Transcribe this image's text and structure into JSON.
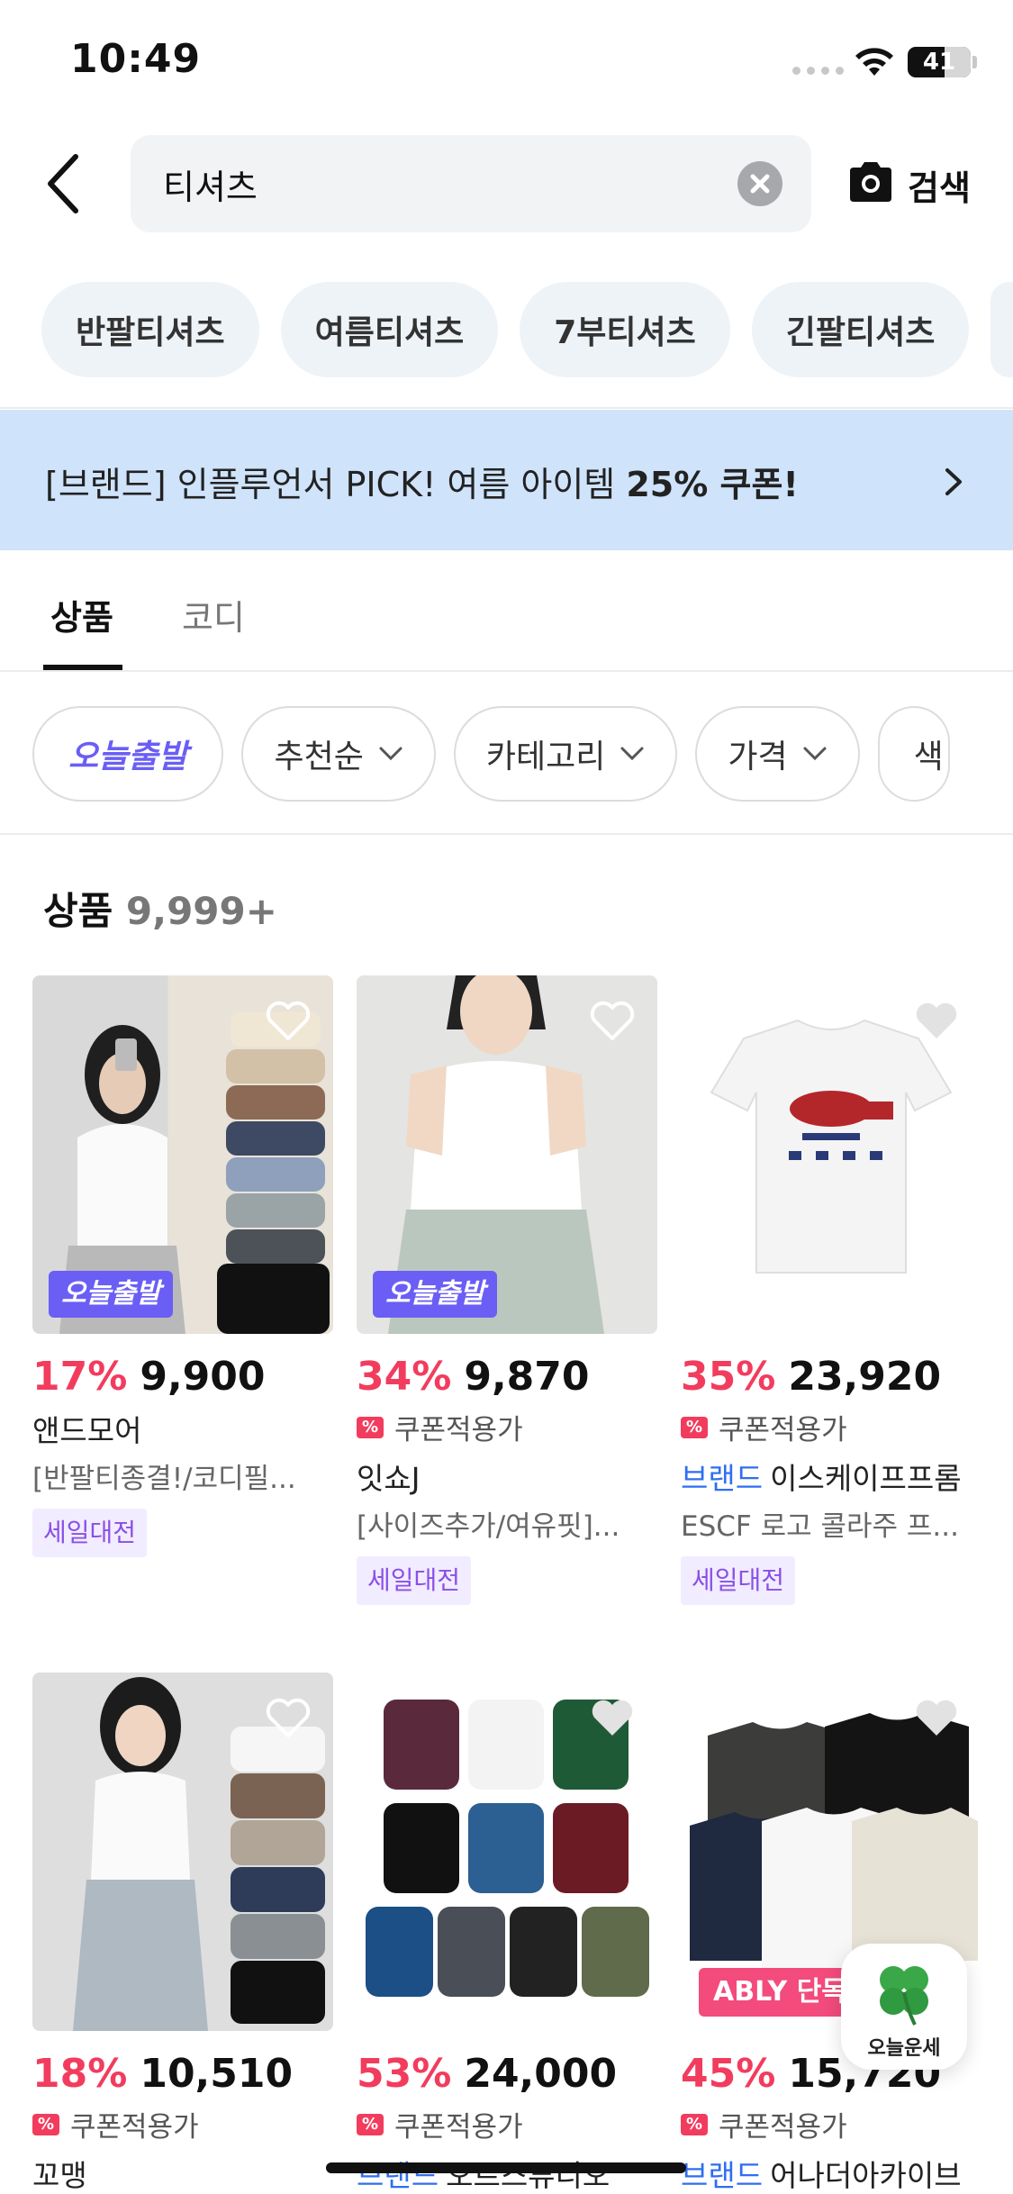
{
  "status_bar": {
    "time": "10:49",
    "battery": "41"
  },
  "search": {
    "query": "티셔츠",
    "submit_label": "검색"
  },
  "keyword_chips": [
    "반팔티셔츠",
    "여름티셔츠",
    "7부티셔츠",
    "긴팔티셔츠"
  ],
  "banner": {
    "text_prefix": "[브랜드] 인플루언서 PICK! 여름 아이템 ",
    "text_bold": "25% 쿠폰!"
  },
  "tabs": {
    "products": "상품",
    "coordi": "코디"
  },
  "filters": {
    "today": "오늘출발",
    "sort": "추천순",
    "category": "카테고리",
    "price": "가격",
    "color_partial": "색"
  },
  "product_count": {
    "label": "상품",
    "value": "9,999+"
  },
  "products": [
    {
      "discount": "17%",
      "price": "9,900",
      "store": "앤드모어",
      "desc": "[반팔티종결!/코디필...",
      "tag": "세일대전",
      "badge": "오늘출발"
    },
    {
      "discount": "34%",
      "price": "9,870",
      "coupon": "쿠폰적용가",
      "store": "잇쇼J",
      "desc": "[사이즈추가/여유핏]...",
      "tag": "세일대전",
      "badge": "오늘출발"
    },
    {
      "discount": "35%",
      "price": "23,920",
      "coupon": "쿠폰적용가",
      "brand_tag": "브랜드",
      "store": "이스케이프프롬",
      "desc": "ESCF 로고 콜라주 프...",
      "tag": "세일대전"
    },
    {
      "discount": "18%",
      "price": "10,510",
      "coupon": "쿠폰적용가",
      "store": "꼬맹"
    },
    {
      "discount": "53%",
      "price": "24,000",
      "coupon": "쿠폰적용가",
      "brand_tag": "브랜드",
      "store": "오르스튜디오"
    },
    {
      "discount": "45%",
      "price": "15,720",
      "coupon": "쿠폰적용가",
      "brand_tag": "브랜드",
      "store": "어나더아카이브",
      "badge": "ABLY 단독"
    }
  ],
  "fortune": {
    "label": "오늘운세"
  },
  "colors": {
    "accent_red": "#f23c5e",
    "accent_purple": "#6a5ef5",
    "brand_blue": "#2f6ef0",
    "banner_bg": "#cfe3fb"
  }
}
